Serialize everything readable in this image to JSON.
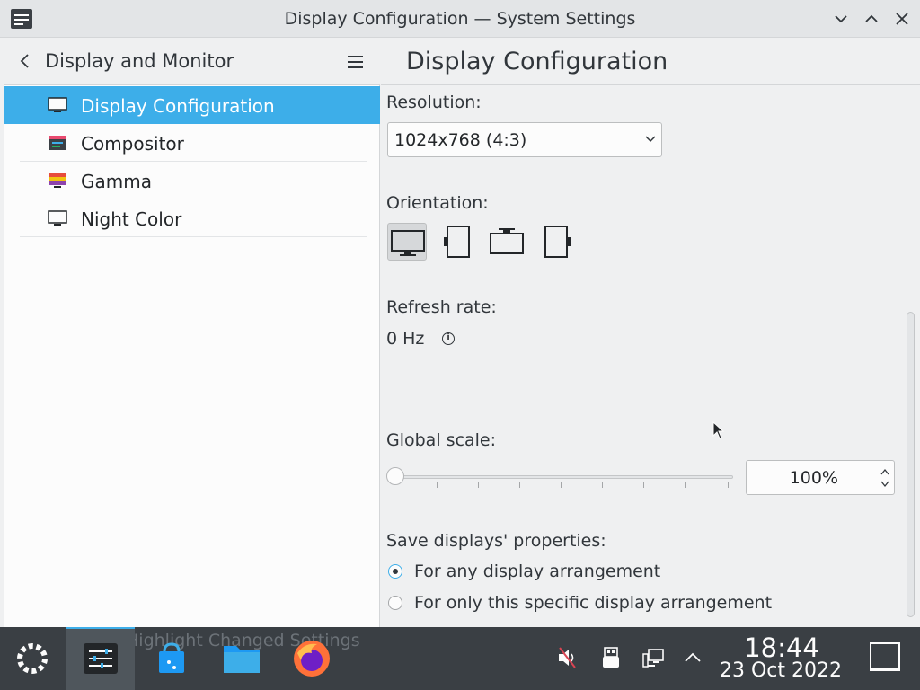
{
  "window": {
    "title": "Display Configuration — System Settings"
  },
  "sidebar": {
    "title": "Display and Monitor",
    "items": [
      {
        "label": "Display Configuration",
        "icon": "monitor-icon",
        "active": true
      },
      {
        "label": "Compositor",
        "icon": "compositor-icon",
        "active": false
      },
      {
        "label": "Gamma",
        "icon": "gamma-icon",
        "active": false
      },
      {
        "label": "Night Color",
        "icon": "night-color-icon",
        "active": false
      }
    ]
  },
  "content": {
    "title": "Display Configuration",
    "resolution_label": "Resolution:",
    "resolution_value": "1024x768 (4:3)",
    "orientation_label": "Orientation:",
    "orientation_options": [
      "landscape",
      "portrait-left",
      "landscape-flipped",
      "portrait-right"
    ],
    "orientation_selected": "landscape",
    "refresh_label": "Refresh rate:",
    "refresh_value": "0 Hz",
    "scale_label": "Global scale:",
    "scale_value": "100%",
    "scale_level": 0,
    "save_label": "Save displays' properties:",
    "save_options": [
      {
        "label": "For any display arrangement",
        "checked": true
      },
      {
        "label": "For only this specific display arrangement",
        "checked": false
      }
    ]
  },
  "taskbar": {
    "ghost_text": "Highlight Changed Settings",
    "apps": [
      "app-launcher-icon",
      "system-settings-icon",
      "discover-icon",
      "dolphin-icon",
      "firefox-icon"
    ],
    "tray": [
      "volume-muted-icon",
      "usb-device-icon",
      "network-icon",
      "chevron-up-icon"
    ],
    "time": "18:44",
    "date": "23 Oct 2022"
  },
  "colors": {
    "accent": "#3daee9",
    "taskbar": "#3a3f44",
    "window_bg": "#eff0f1"
  }
}
